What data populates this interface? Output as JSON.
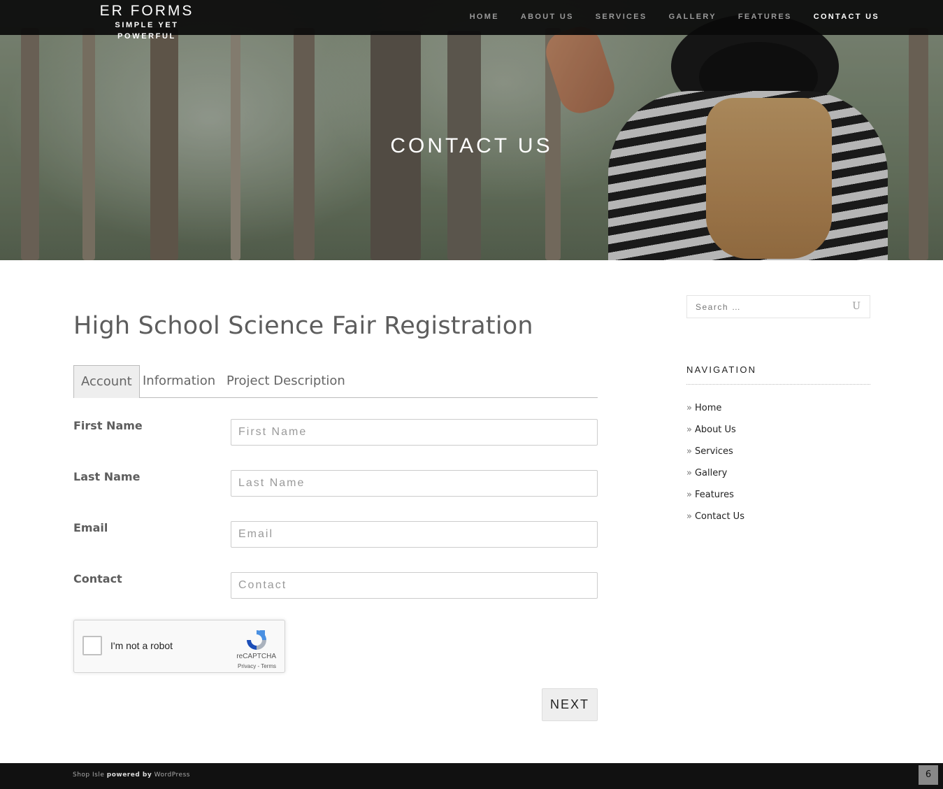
{
  "brand": {
    "title": "ER FORMS",
    "subtitle": "SIMPLE YET POWERFUL"
  },
  "nav": {
    "items": [
      {
        "label": "HOME"
      },
      {
        "label": "ABOUT US"
      },
      {
        "label": "SERVICES"
      },
      {
        "label": "GALLERY"
      },
      {
        "label": "FEATURES"
      },
      {
        "label": "CONTACT US"
      }
    ],
    "active": "CONTACT US"
  },
  "hero": {
    "title": "CONTACT US"
  },
  "form": {
    "title": "High School Science Fair Registration",
    "tabs": [
      {
        "label": "Account"
      },
      {
        "label": "Information"
      },
      {
        "label": "Project Description"
      }
    ],
    "active_tab": "Account",
    "fields": [
      {
        "label": "First Name",
        "placeholder": "First Name",
        "value": ""
      },
      {
        "label": "Last Name",
        "placeholder": "Last Name",
        "value": ""
      },
      {
        "label": "Email",
        "placeholder": "Email",
        "value": ""
      },
      {
        "label": "Contact",
        "placeholder": "Contact",
        "value": ""
      }
    ],
    "captcha": {
      "label": "I'm not a robot",
      "brand": "reCAPTCHA",
      "terms": "Privacy - Terms"
    },
    "next_label": "NEXT"
  },
  "sidebar": {
    "search_placeholder": "Search …",
    "search_icon": "U",
    "nav_title": "NAVIGATION",
    "nav_items": [
      {
        "label": "Home"
      },
      {
        "label": "About Us"
      },
      {
        "label": "Services"
      },
      {
        "label": "Gallery"
      },
      {
        "label": "Features"
      },
      {
        "label": "Contact Us"
      }
    ],
    "bullet": "»"
  },
  "footer": {
    "theme": "Shop Isle",
    "powered": "powered by",
    "platform": "WordPress",
    "scroll_top": "6"
  }
}
